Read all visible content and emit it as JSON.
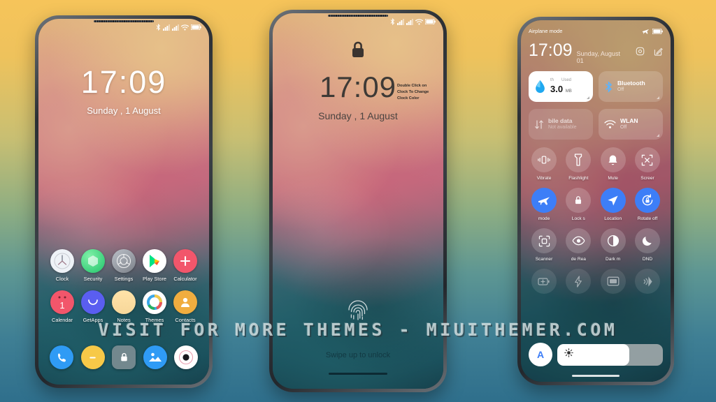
{
  "watermark": "VISIT FOR MORE THEMES - MIUITHEMER.COM",
  "colors": {
    "bg_top": "#f6c45a",
    "bg_bottom": "#2f6f8c",
    "accent_blue": "#3d7ef7",
    "tile_white": "#ffffff"
  },
  "phone1": {
    "name": "home-screen",
    "status_icons": [
      "bluetooth-icon",
      "signal-icon",
      "signal-icon",
      "wifi-icon",
      "battery-icon"
    ],
    "clock": {
      "time": "17:09",
      "date": "Sunday , 1 August"
    },
    "apps_row1": [
      {
        "label": "Clock",
        "icon": "clock-icon"
      },
      {
        "label": "Security",
        "icon": "security-icon"
      },
      {
        "label": "Settings",
        "icon": "settings-icon"
      },
      {
        "label": "Play Store",
        "icon": "play-store-icon"
      },
      {
        "label": "Calculator",
        "icon": "calculator-icon"
      }
    ],
    "apps_row2": [
      {
        "label": "Calendar",
        "icon": "calendar-icon",
        "day": "1"
      },
      {
        "label": "GetApps",
        "icon": "getapps-icon"
      },
      {
        "label": "Notes",
        "icon": "notes-icon"
      },
      {
        "label": "Themes",
        "icon": "themes-icon"
      },
      {
        "label": "Contacts",
        "icon": "contacts-icon"
      }
    ],
    "dock": [
      {
        "label": "Phone",
        "icon": "phone-icon"
      },
      {
        "label": "Messages",
        "icon": "messages-icon"
      },
      {
        "label": "Security",
        "icon": "lock-icon"
      },
      {
        "label": "Gallery",
        "icon": "gallery-icon"
      },
      {
        "label": "Camera",
        "icon": "camera-icon"
      }
    ]
  },
  "phone2": {
    "name": "lock-screen",
    "status_icons": [
      "bluetooth-icon",
      "signal-icon",
      "signal-icon",
      "wifi-icon",
      "battery-icon"
    ],
    "lock_icon": "padlock-icon",
    "clock": {
      "time": "17:09",
      "date": "Sunday , 1 August"
    },
    "hint": "Double Click on Clock To Change Clock Color",
    "fingerprint_icon": "fingerprint-icon",
    "unlock_text": "Swipe up to unlock"
  },
  "phone3": {
    "name": "control-center",
    "status_left": "Airplane mode",
    "status_icons": [
      "airplane-icon",
      "battery-icon"
    ],
    "clock": {
      "time": "17:09",
      "date": "Sunday, August 01"
    },
    "header_icons": [
      "settings-gear-icon",
      "edit-icon"
    ],
    "big_tiles": [
      {
        "name": "data-usage",
        "icon": "data-drop-icon",
        "label_left": "th",
        "label_right": "Used",
        "value": "3.0",
        "unit": "MB",
        "style": "white"
      },
      {
        "name": "bluetooth",
        "icon": "bluetooth-icon",
        "title": "Bluetooth",
        "subtitle": "Off",
        "style": "translucent"
      },
      {
        "name": "mobile-data",
        "icon": "mobile-data-icon",
        "title": "bile data",
        "subtitle": "Not available",
        "style": "translucent"
      },
      {
        "name": "wlan",
        "icon": "wifi-icon",
        "title": "WLAN",
        "subtitle": "Off",
        "style": "translucent"
      }
    ],
    "toggles_row1": [
      {
        "label": "Vibrate",
        "icon": "vibrate-icon",
        "on": false
      },
      {
        "label": "Flashlight",
        "icon": "flashlight-icon",
        "on": false
      },
      {
        "label": "Mute",
        "icon": "bell-icon",
        "on": false
      },
      {
        "label": "Screer",
        "icon": "screenshot-icon",
        "on": false
      }
    ],
    "toggles_row2": [
      {
        "label": "mode",
        "icon": "airplane-icon",
        "on": true
      },
      {
        "label": "Lock s",
        "icon": "lock-icon",
        "on": false
      },
      {
        "label": "Location",
        "icon": "location-icon",
        "on": true
      },
      {
        "label": "Rotate off",
        "icon": "rotate-lock-icon",
        "on": true
      }
    ],
    "toggles_row3": [
      {
        "label": "Scanner",
        "icon": "scanner-icon",
        "on": false
      },
      {
        "label": "de  Rea",
        "icon": "eye-icon",
        "on": false
      },
      {
        "label": "Dark m",
        "icon": "contrast-icon",
        "on": false
      },
      {
        "label": "DND",
        "icon": "moon-icon",
        "on": false
      }
    ],
    "toggles_row4": [
      {
        "label": "",
        "icon": "battery-saver-icon",
        "on": false
      },
      {
        "label": "",
        "icon": "ultra-battery-icon",
        "on": false
      },
      {
        "label": "",
        "icon": "cast-icon",
        "on": false
      },
      {
        "label": "",
        "icon": "nfc-icon",
        "on": false
      }
    ],
    "brightness": {
      "auto_label": "A",
      "icon": "sun-icon",
      "level": "68"
    }
  }
}
